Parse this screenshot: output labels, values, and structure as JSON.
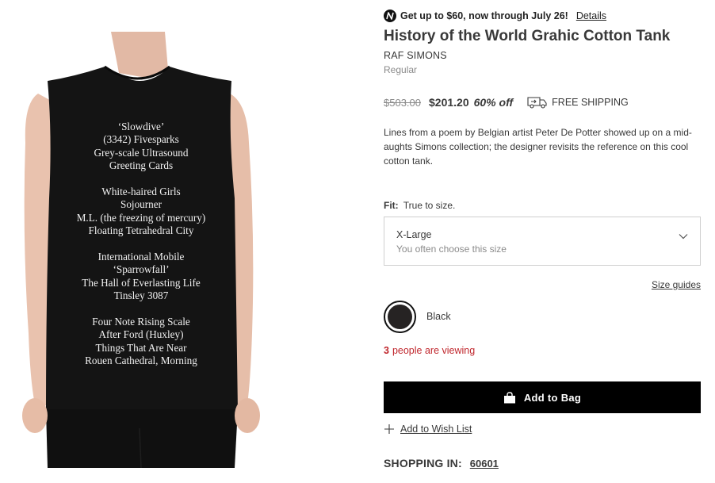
{
  "promo": {
    "icon": "nordstrom-n-icon",
    "text": "Get up to $60, now through July 26!",
    "link": "Details"
  },
  "product": {
    "title": "History of the World Grahic Cotton Tank",
    "brand": "RAF SIMONS",
    "size_type": "Regular",
    "original_price": "$503.00",
    "sale_price": "$201.20",
    "discount": "60% off",
    "shipping": "FREE SHIPPING",
    "description": "Lines from a poem by Belgian artist Peter De Potter showed up on a mid-aughts Simons collection; the designer revisits the reference on this cool cotton tank."
  },
  "image": {
    "shirt_color": "#141414",
    "text_color": "#f1f1f1",
    "stanzas": [
      [
        "‘Slowdive’",
        "(3342) Fivesparks",
        "Grey-scale Ultrasound",
        "Greeting Cards"
      ],
      [
        "White-haired Girls",
        "Sojourner",
        "M.L. (the freezing of mercury)",
        "Floating Tetrahedral City"
      ],
      [
        "International Mobile",
        "‘Sparrowfall’",
        "The Hall of Everlasting Life",
        "Tinsley 3087"
      ],
      [
        "Four Note Rising Scale",
        "After Ford (Huxley)",
        "Things That Are Near",
        "Rouen Cathedral, Morning"
      ]
    ]
  },
  "fit": {
    "label": "Fit:",
    "value": "True to size."
  },
  "size_select": {
    "value": "X-Large",
    "hint": "You often choose this size"
  },
  "size_guides": "Size guides",
  "color": {
    "name": "Black",
    "swatch": "#262323"
  },
  "viewing": {
    "count": "3",
    "text": "people are viewing"
  },
  "add_to_bag": "Add to Bag",
  "wishlist": "Add to Wish List",
  "shopping_in": {
    "label": "SHOPPING IN:",
    "zip": "60601"
  },
  "colors": {
    "alert_red": "#c0272d",
    "button_black": "#000000",
    "text_gray": "#393939",
    "muted_gray": "#8a8a8a"
  }
}
